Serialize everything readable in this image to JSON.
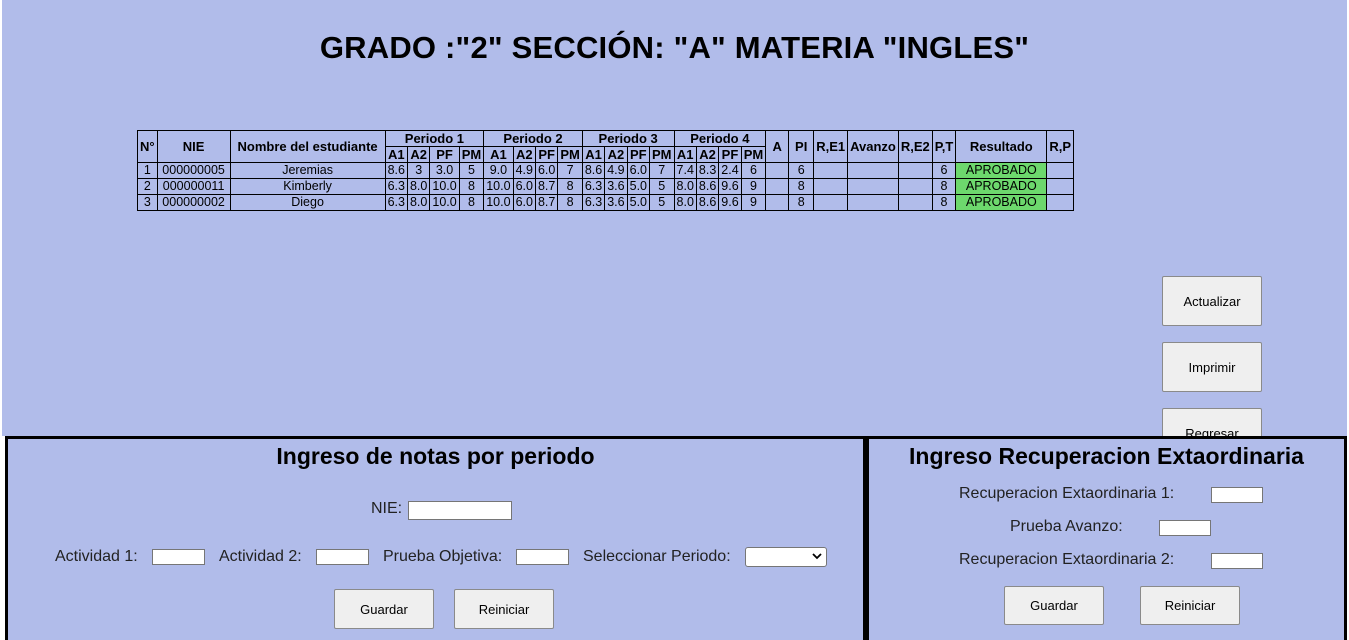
{
  "page": {
    "title": "GRADO :\"2\" SECCIÓN: \"A\" MATERIA \"INGLES\""
  },
  "table": {
    "headers": {
      "num": "N°",
      "nie": "NIE",
      "name": "Nombre del estudiante",
      "periods": [
        "Periodo 1",
        "Periodo 2",
        "Periodo 3",
        "Periodo 4"
      ],
      "sub": [
        "A1",
        "A2",
        "PF",
        "PM"
      ],
      "a": "A",
      "pi": "PI",
      "re1": "R,E1",
      "avanzo": "Avanzo",
      "re2": "R,E2",
      "pt": "P,T",
      "resultado": "Resultado",
      "rp": "R,P"
    },
    "rows": [
      {
        "num": "1",
        "nie": "000000005",
        "name": "Jeremias",
        "p1": [
          "8.6",
          "3",
          "3.0",
          "5"
        ],
        "p2": [
          "9.0",
          "4.9",
          "6.0",
          "7"
        ],
        "p3": [
          "8.6",
          "4.9",
          "6.0",
          "7"
        ],
        "p4": [
          "7.4",
          "8.3",
          "2.4",
          "6"
        ],
        "a": "",
        "pi": "6",
        "re1": "",
        "avanzo": "",
        "re2": "",
        "pt": "6",
        "resultado": "APROBADO",
        "rp": ""
      },
      {
        "num": "2",
        "nie": "000000011",
        "name": "Kimberly",
        "p1": [
          "6.3",
          "8.0",
          "10.0",
          "8"
        ],
        "p2": [
          "10.0",
          "6.0",
          "8.7",
          "8"
        ],
        "p3": [
          "6.3",
          "3.6",
          "5.0",
          "5"
        ],
        "p4": [
          "8.0",
          "8.6",
          "9.6",
          "9"
        ],
        "a": "",
        "pi": "8",
        "re1": "",
        "avanzo": "",
        "re2": "",
        "pt": "8",
        "resultado": "APROBADO",
        "rp": ""
      },
      {
        "num": "3",
        "nie": "000000002",
        "name": "Diego",
        "p1": [
          "6.3",
          "8.0",
          "10.0",
          "8"
        ],
        "p2": [
          "10.0",
          "6.0",
          "8.7",
          "8"
        ],
        "p3": [
          "6.3",
          "3.6",
          "5.0",
          "5"
        ],
        "p4": [
          "8.0",
          "8.6",
          "9.6",
          "9"
        ],
        "a": "",
        "pi": "8",
        "re1": "",
        "avanzo": "",
        "re2": "",
        "pt": "8",
        "resultado": "APROBADO",
        "rp": ""
      }
    ]
  },
  "actions": {
    "actualizar": "Actualizar",
    "imprimir": "Imprimir",
    "regresar": "Regresar"
  },
  "left_panel": {
    "title": "Ingreso de notas por periodo",
    "nie_label": "NIE:",
    "nie_value": "",
    "act1_label": "Actividad 1:",
    "act1_value": "",
    "act2_label": "Actividad 2:",
    "act2_value": "",
    "prueba_label": "Prueba Objetiva:",
    "prueba_value": "",
    "periodo_label": "Seleccionar Periodo:",
    "periodo_value": "",
    "guardar": "Guardar",
    "reiniciar": "Reiniciar"
  },
  "right_panel": {
    "title": "Ingreso Recuperacion Extaordinaria",
    "rec1_label": "Recuperacion Extaordinaria 1:",
    "rec1_value": "",
    "avanzo_label": "Prueba Avanzo:",
    "avanzo_value": "",
    "rec2_label": "Recuperacion Extaordinaria 2:",
    "rec2_value": "",
    "guardar": "Guardar",
    "reiniciar": "Reiniciar"
  },
  "colors": {
    "background": "#b1bcea",
    "approved": "#6dd86d",
    "button": "#efefef"
  },
  "icons": {
    "select_arrow": "chevron-down-icon"
  }
}
